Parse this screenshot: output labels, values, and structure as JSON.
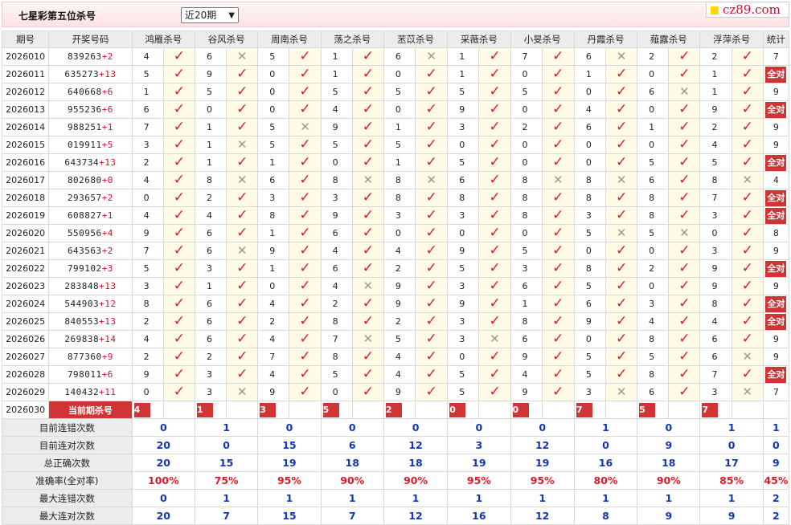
{
  "header": {
    "title": "七星彩第五位杀号",
    "period_select": "近20期",
    "logo": "cz89.com"
  },
  "columns": {
    "period": "期号",
    "numbers": "开奖号码",
    "experts": [
      "鸿雁杀号",
      "谷风杀号",
      "周南杀号",
      "荡之杀号",
      "苤苡杀号",
      "采薇杀号",
      "小旻杀号",
      "丹霞杀号",
      "薤露杀号",
      "浮萍杀号"
    ],
    "stat": "统计"
  },
  "rows": [
    {
      "period": "2026010",
      "numbers": "839263",
      "sum": "+2",
      "kills": [
        "4",
        "6",
        "5",
        "1",
        "6",
        "1",
        "7",
        "6",
        "2",
        "2"
      ],
      "marks": [
        "v",
        "x",
        "v",
        "v",
        "x",
        "v",
        "v",
        "x",
        "v",
        "v"
      ],
      "stat": "7"
    },
    {
      "period": "2026011",
      "numbers": "635273",
      "sum": "+13",
      "kills": [
        "5",
        "9",
        "0",
        "1",
        "0",
        "1",
        "0",
        "1",
        "0",
        "1"
      ],
      "marks": [
        "v",
        "v",
        "v",
        "v",
        "v",
        "v",
        "v",
        "v",
        "v",
        "v"
      ],
      "stat": "全对"
    },
    {
      "period": "2026012",
      "numbers": "640668",
      "sum": "+6",
      "kills": [
        "1",
        "5",
        "0",
        "5",
        "5",
        "5",
        "5",
        "0",
        "6",
        "1"
      ],
      "marks": [
        "v",
        "v",
        "v",
        "v",
        "v",
        "v",
        "v",
        "v",
        "x",
        "v"
      ],
      "stat": "9"
    },
    {
      "period": "2026013",
      "numbers": "955236",
      "sum": "+6",
      "kills": [
        "6",
        "0",
        "0",
        "4",
        "0",
        "9",
        "0",
        "4",
        "0",
        "9"
      ],
      "marks": [
        "v",
        "v",
        "v",
        "v",
        "v",
        "v",
        "v",
        "v",
        "v",
        "v"
      ],
      "stat": "全对"
    },
    {
      "period": "2026014",
      "numbers": "988251",
      "sum": "+1",
      "kills": [
        "7",
        "1",
        "5",
        "9",
        "1",
        "3",
        "2",
        "6",
        "1",
        "2"
      ],
      "marks": [
        "v",
        "v",
        "x",
        "v",
        "v",
        "v",
        "v",
        "v",
        "v",
        "v"
      ],
      "stat": "9"
    },
    {
      "period": "2026015",
      "numbers": "019911",
      "sum": "+5",
      "kills": [
        "3",
        "1",
        "5",
        "5",
        "5",
        "0",
        "0",
        "0",
        "0",
        "4"
      ],
      "marks": [
        "v",
        "x",
        "v",
        "v",
        "v",
        "v",
        "v",
        "v",
        "v",
        "v"
      ],
      "stat": "9"
    },
    {
      "period": "2026016",
      "numbers": "643734",
      "sum": "+13",
      "kills": [
        "2",
        "1",
        "1",
        "0",
        "1",
        "5",
        "0",
        "0",
        "5",
        "5"
      ],
      "marks": [
        "v",
        "v",
        "v",
        "v",
        "v",
        "v",
        "v",
        "v",
        "v",
        "v"
      ],
      "stat": "全对"
    },
    {
      "period": "2026017",
      "numbers": "802680",
      "sum": "+0",
      "kills": [
        "4",
        "8",
        "6",
        "8",
        "8",
        "6",
        "8",
        "8",
        "6",
        "8"
      ],
      "marks": [
        "v",
        "x",
        "v",
        "x",
        "x",
        "v",
        "x",
        "x",
        "v",
        "x"
      ],
      "stat": "4"
    },
    {
      "period": "2026018",
      "numbers": "293657",
      "sum": "+2",
      "kills": [
        "0",
        "2",
        "3",
        "3",
        "8",
        "8",
        "8",
        "8",
        "8",
        "7"
      ],
      "marks": [
        "v",
        "v",
        "v",
        "v",
        "v",
        "v",
        "v",
        "v",
        "v",
        "v"
      ],
      "stat": "全对"
    },
    {
      "period": "2026019",
      "numbers": "608827",
      "sum": "+1",
      "kills": [
        "4",
        "4",
        "8",
        "9",
        "3",
        "3",
        "8",
        "3",
        "8",
        "3"
      ],
      "marks": [
        "v",
        "v",
        "v",
        "v",
        "v",
        "v",
        "v",
        "v",
        "v",
        "v"
      ],
      "stat": "全对"
    },
    {
      "period": "2026020",
      "numbers": "550956",
      "sum": "+4",
      "kills": [
        "9",
        "6",
        "1",
        "6",
        "0",
        "0",
        "0",
        "5",
        "5",
        "0"
      ],
      "marks": [
        "v",
        "v",
        "v",
        "v",
        "v",
        "v",
        "v",
        "x",
        "x",
        "v"
      ],
      "stat": "8"
    },
    {
      "period": "2026021",
      "numbers": "643563",
      "sum": "+2",
      "kills": [
        "7",
        "6",
        "9",
        "4",
        "4",
        "9",
        "5",
        "0",
        "0",
        "3"
      ],
      "marks": [
        "v",
        "x",
        "v",
        "v",
        "v",
        "v",
        "v",
        "v",
        "v",
        "v"
      ],
      "stat": "9"
    },
    {
      "period": "2026022",
      "numbers": "799102",
      "sum": "+3",
      "kills": [
        "5",
        "3",
        "1",
        "6",
        "2",
        "5",
        "3",
        "8",
        "2",
        "9"
      ],
      "marks": [
        "v",
        "v",
        "v",
        "v",
        "v",
        "v",
        "v",
        "v",
        "v",
        "v"
      ],
      "stat": "全对"
    },
    {
      "period": "2026023",
      "numbers": "283848",
      "sum": "+13",
      "kills": [
        "3",
        "1",
        "0",
        "4",
        "9",
        "3",
        "6",
        "5",
        "0",
        "9"
      ],
      "marks": [
        "v",
        "v",
        "v",
        "x",
        "v",
        "v",
        "v",
        "v",
        "v",
        "v"
      ],
      "stat": "9"
    },
    {
      "period": "2026024",
      "numbers": "544903",
      "sum": "+12",
      "kills": [
        "8",
        "6",
        "4",
        "2",
        "9",
        "9",
        "1",
        "6",
        "3",
        "8"
      ],
      "marks": [
        "v",
        "v",
        "v",
        "v",
        "v",
        "v",
        "v",
        "v",
        "v",
        "v"
      ],
      "stat": "全对"
    },
    {
      "period": "2026025",
      "numbers": "840553",
      "sum": "+13",
      "kills": [
        "2",
        "6",
        "2",
        "8",
        "2",
        "3",
        "8",
        "9",
        "4",
        "4"
      ],
      "marks": [
        "v",
        "v",
        "v",
        "v",
        "v",
        "v",
        "v",
        "v",
        "v",
        "v"
      ],
      "stat": "全对"
    },
    {
      "period": "2026026",
      "numbers": "269838",
      "sum": "+14",
      "kills": [
        "4",
        "6",
        "4",
        "7",
        "5",
        "3",
        "6",
        "0",
        "8",
        "6"
      ],
      "marks": [
        "v",
        "v",
        "v",
        "x",
        "v",
        "x",
        "v",
        "v",
        "v",
        "v"
      ],
      "stat": "9"
    },
    {
      "period": "2026027",
      "numbers": "877360",
      "sum": "+9",
      "kills": [
        "2",
        "2",
        "7",
        "8",
        "4",
        "0",
        "9",
        "5",
        "5",
        "6"
      ],
      "marks": [
        "v",
        "v",
        "v",
        "v",
        "v",
        "v",
        "v",
        "v",
        "v",
        "x"
      ],
      "stat": "9"
    },
    {
      "period": "2026028",
      "numbers": "798011",
      "sum": "+6",
      "kills": [
        "9",
        "3",
        "4",
        "5",
        "4",
        "5",
        "4",
        "5",
        "8",
        "7"
      ],
      "marks": [
        "v",
        "v",
        "v",
        "v",
        "v",
        "v",
        "v",
        "v",
        "v",
        "v"
      ],
      "stat": "全对"
    },
    {
      "period": "2026029",
      "numbers": "140432",
      "sum": "+11",
      "kills": [
        "0",
        "3",
        "9",
        "0",
        "9",
        "5",
        "9",
        "3",
        "6",
        "3"
      ],
      "marks": [
        "v",
        "x",
        "v",
        "v",
        "v",
        "v",
        "v",
        "x",
        "v",
        "x"
      ],
      "stat": "7"
    }
  ],
  "current": {
    "period": "2026030",
    "label": "当前期杀号",
    "kills": [
      "4",
      "1",
      "3",
      "5",
      "2",
      "0",
      "0",
      "7",
      "5",
      "7"
    ]
  },
  "summary": [
    {
      "label": "目前连错次数",
      "values": [
        "0",
        "1",
        "0",
        "0",
        "0",
        "0",
        "0",
        "1",
        "0",
        "1"
      ],
      "stat": "1",
      "style": "v"
    },
    {
      "label": "目前连对次数",
      "values": [
        "20",
        "0",
        "15",
        "6",
        "12",
        "3",
        "12",
        "0",
        "9",
        "0"
      ],
      "stat": "0",
      "style": "v"
    },
    {
      "label": "总正确次数",
      "values": [
        "20",
        "15",
        "19",
        "18",
        "18",
        "19",
        "19",
        "16",
        "18",
        "17"
      ],
      "stat": "9",
      "style": "v"
    },
    {
      "label": "准确率(全对率)",
      "values": [
        "100%",
        "75%",
        "95%",
        "90%",
        "90%",
        "95%",
        "95%",
        "80%",
        "90%",
        "85%"
      ],
      "stat": "45%",
      "style": "pct"
    },
    {
      "label": "最大连错次数",
      "values": [
        "0",
        "1",
        "1",
        "1",
        "1",
        "1",
        "1",
        "1",
        "1",
        "1"
      ],
      "stat": "2",
      "style": "v"
    },
    {
      "label": "最大连对次数",
      "values": [
        "20",
        "7",
        "15",
        "7",
        "12",
        "16",
        "12",
        "8",
        "9",
        "9"
      ],
      "stat": "2",
      "style": "v"
    }
  ],
  "colors": {
    "accent_red": "#d13434",
    "check_red": "#d91c2a",
    "value_blue": "#1336b3",
    "header_gray": "#ececec",
    "mark_bg": "#fffbe6"
  }
}
